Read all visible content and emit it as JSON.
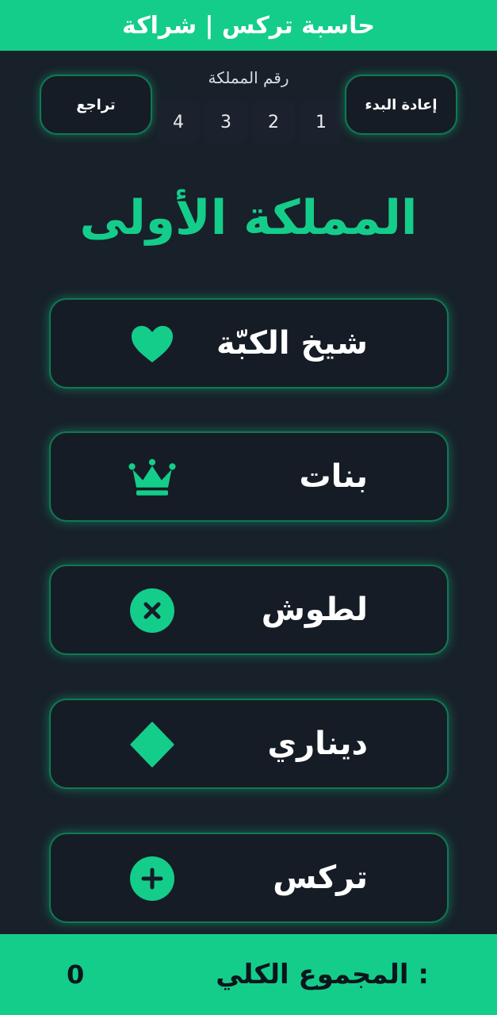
{
  "app_title": "حاسبة تركس | شراكة",
  "controls": {
    "undo_label": "تراجع",
    "reset_label": "إعادة البدء",
    "kingdom_number_label": "رقم المملكة",
    "kingdom_numbers": [
      "1",
      "2",
      "3",
      "4"
    ]
  },
  "kingdom_title": "المملكة الأولى",
  "games": [
    {
      "label": "شيخ الكبّة",
      "icon": "heart-icon"
    },
    {
      "label": "بنات",
      "icon": "crown-icon"
    },
    {
      "label": "لطوش",
      "icon": "x-circle-icon"
    },
    {
      "label": "ديناري",
      "icon": "diamond-icon"
    },
    {
      "label": "تركس",
      "icon": "plus-circle-icon"
    }
  ],
  "footer": {
    "total_label": "المجموع الكلي :",
    "total_value": "0"
  },
  "colors": {
    "accent": "#14cd8a",
    "background": "#182029",
    "card": "#161c26"
  }
}
